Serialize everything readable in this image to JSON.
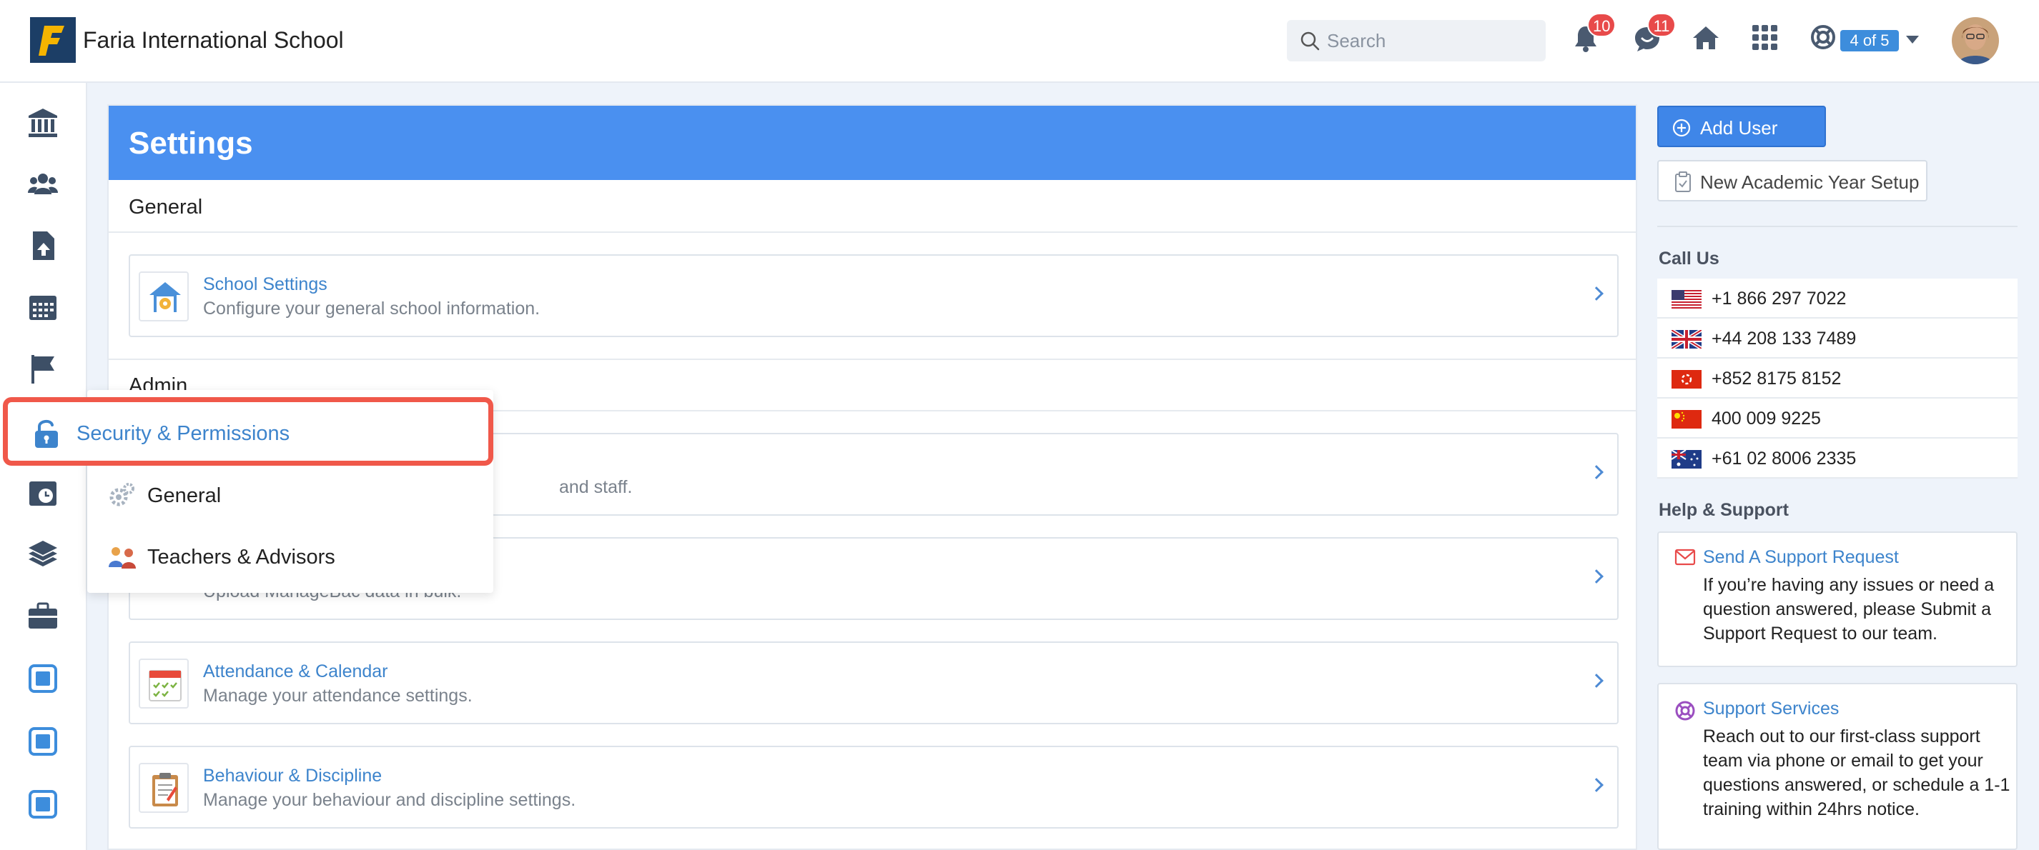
{
  "topbar": {
    "school_name": "Faria International School",
    "search_placeholder": "Search",
    "notifications_count": "10",
    "messages_count": "11",
    "progress_label": "4 of 5"
  },
  "main": {
    "title": "Settings",
    "sections": {
      "general": "General",
      "admin": "Admin"
    },
    "cards": [
      {
        "title": "School Settings",
        "desc": "Configure your general school information."
      },
      {
        "title": "",
        "desc": "and staff."
      },
      {
        "title": "",
        "desc": "Upload ManageBac data in bulk."
      },
      {
        "title": "Attendance & Calendar",
        "desc": "Manage your attendance settings."
      },
      {
        "title": "Behaviour & Discipline",
        "desc": "Manage your behaviour and discipline settings."
      }
    ]
  },
  "flyout": {
    "highlighted_item": "Security & Permissions",
    "items": [
      "General",
      "Teachers & Advisors"
    ]
  },
  "right": {
    "add_user": "Add User",
    "new_year": "New Academic Year Setup",
    "call_us": "Call Us",
    "phones": [
      "+1 866 297 7022",
      "+44 208 133 7489",
      "+852 8175 8152",
      "400 009 9225",
      "+61 02 8006 2335"
    ],
    "help_heading": "Help & Support",
    "support_request": {
      "title": "Send A Support Request",
      "body": "If you’re having any issues or need a question answered, please Submit a Support Request to our team."
    },
    "support_services": {
      "title": "Support Services",
      "body": "Reach out to our first-class support team via phone or email to get your questions answered, or schedule a 1-1 training within 24hrs notice."
    }
  },
  "colors": {
    "header_blue": "#4a90f0",
    "link_blue": "#3d84cc",
    "badge_red": "#e84a4a",
    "highlight_red": "#f0584a"
  },
  "icons": {
    "sidebar": [
      "bank-icon",
      "users-icon",
      "file-upload-icon",
      "calendar-icon",
      "flag-icon",
      "lock-icon",
      "calendar-clock-icon",
      "layers-icon",
      "briefcase-icon",
      "dp-icon",
      "cp-icon",
      "myp-icon"
    ]
  }
}
